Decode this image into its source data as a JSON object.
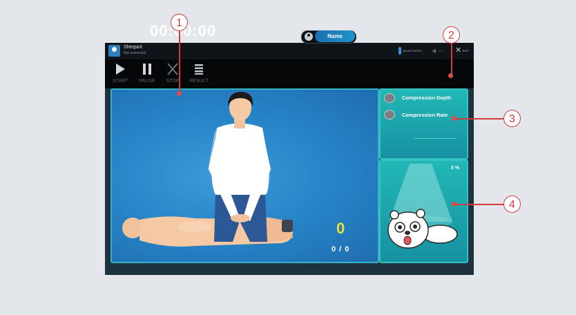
{
  "app": {
    "name": "SherpaX",
    "status": "Not connected",
    "bluetooth_label": "BLUETOOTH",
    "volume_label": "OFF",
    "exit_label": "EXIT"
  },
  "toolbar": {
    "start_label": "START",
    "pause_label": "PAUSE",
    "stop_label": "STOP",
    "result_label": "RESULT",
    "timer": "00:00:00",
    "name_button": "Name"
  },
  "stage": {
    "count": "0",
    "ratio": "0 / 0"
  },
  "feedback": {
    "depth_label": "Compression Depth",
    "rate_label": "Compression Rate"
  },
  "status_panel": {
    "percent": "0 %"
  },
  "callouts": [
    "1",
    "2",
    "3",
    "4"
  ],
  "colors": {
    "accent": "#35c3c0",
    "callout": "#d33b3b",
    "count": "#e8e23a"
  }
}
